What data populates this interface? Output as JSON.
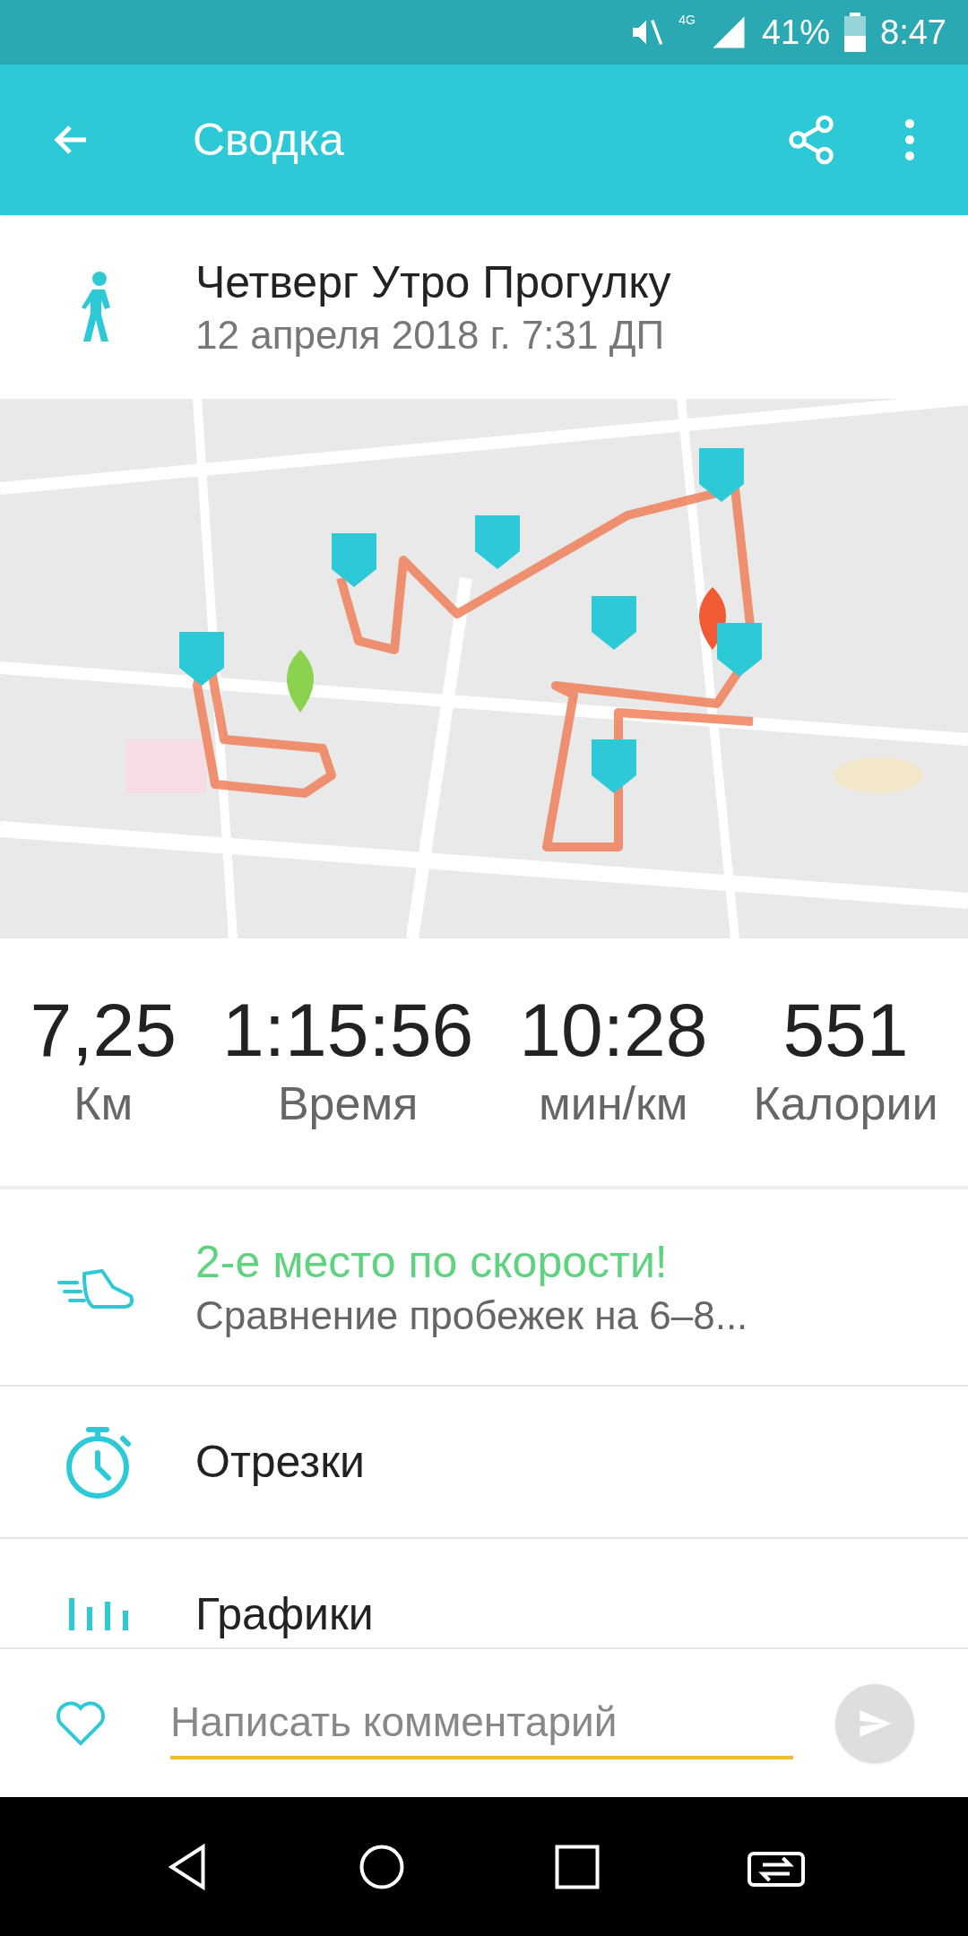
{
  "status_bar": {
    "network": "4G",
    "battery": "41%",
    "time": "8:47"
  },
  "app_bar": {
    "title": "Сводка"
  },
  "activity": {
    "title": "Четверг Утро Прогулку",
    "date": "12 апреля 2018 г. 7:31 ДП"
  },
  "stats": [
    {
      "value": "7,25",
      "label": "Км"
    },
    {
      "value": "1:15:56",
      "label": "Время"
    },
    {
      "value": "10:28",
      "label": "мин/км"
    },
    {
      "value": "551",
      "label": "Калории"
    }
  ],
  "rows": [
    {
      "kind": "achievement",
      "title": "2-е место по скорости!",
      "subtitle": "Сравнение пробежек на 6–8..."
    },
    {
      "kind": "splits",
      "title": "Отрезки"
    },
    {
      "kind": "charts",
      "title": "Графики"
    }
  ],
  "comment": {
    "placeholder": "Написать комментарий"
  }
}
